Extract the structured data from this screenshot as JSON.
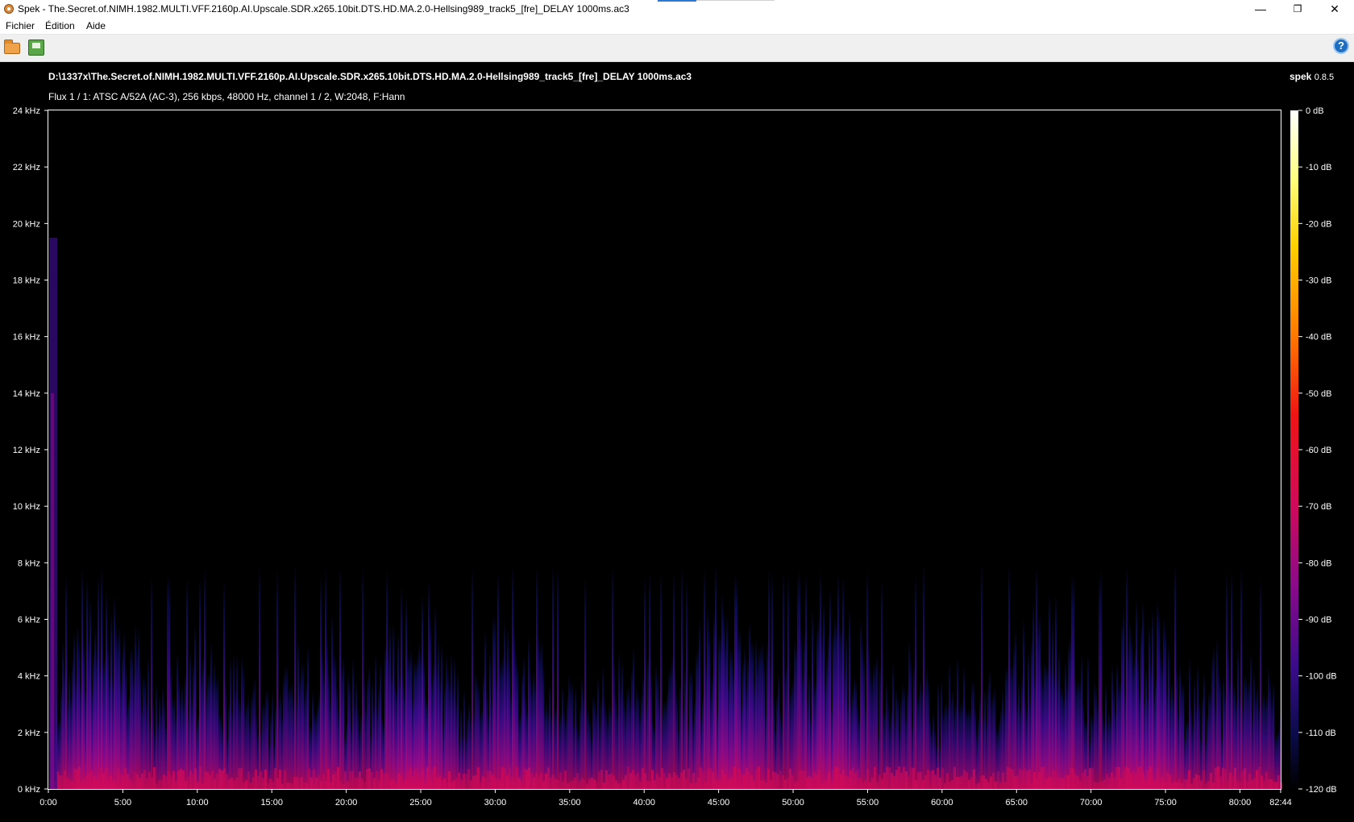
{
  "window": {
    "title": "Spek - The.Secret.of.NIMH.1982.MULTI.VFF.2160p.AI.Upscale.SDR.x265.10bit.DTS.HD.MA.2.0-Hellsing989_track5_[fre]_DELAY 1000ms.ac3",
    "minimize_glyph": "—",
    "restore_glyph": "❐",
    "close_glyph": "✕"
  },
  "menu": {
    "file": "Fichier",
    "edit": "Édition",
    "help": "Aide"
  },
  "toolbar": {
    "open_icon": "folder-open-icon",
    "save_icon": "save-image-icon",
    "help_icon": "help-icon",
    "help_glyph": "?"
  },
  "analysis": {
    "file_path": "D:\\1337x\\The.Secret.of.NIMH.1982.MULTI.VFF.2160p.AI.Upscale.SDR.x265.10bit.DTS.HD.MA.2.0-Hellsing989_track5_[fre]_DELAY 1000ms.ac3",
    "stream_info": "Flux 1 / 1: ATSC A/52A (AC-3), 256 kbps, 48000 Hz, channel 1 / 2, W:2048, F:Hann",
    "brand_name": "spek",
    "brand_version": "0.8.5"
  },
  "chart_data": {
    "type": "heatmap",
    "freq_unit": "kHz",
    "freq_range": [
      0,
      24
    ],
    "freq_ticks": [
      "0 kHz",
      "2 kHz",
      "4 kHz",
      "6 kHz",
      "8 kHz",
      "10 kHz",
      "12 kHz",
      "14 kHz",
      "16 kHz",
      "18 kHz",
      "20 kHz",
      "22 kHz",
      "24 kHz"
    ],
    "time_range_seconds": [
      0,
      4964
    ],
    "time_ticks": [
      "0:00",
      "5:00",
      "10:00",
      "15:00",
      "20:00",
      "25:00",
      "30:00",
      "35:00",
      "40:00",
      "45:00",
      "50:00",
      "55:00",
      "60:00",
      "65:00",
      "70:00",
      "75:00",
      "80:00",
      "82:44"
    ],
    "db_range": [
      -120,
      0
    ],
    "db_ticks": [
      "0 dB",
      "-10 dB",
      "-20 dB",
      "-30 dB",
      "-40 dB",
      "-50 dB",
      "-60 dB",
      "-70 dB",
      "-80 dB",
      "-90 dB",
      "-100 dB",
      "-110 dB",
      "-120 dB"
    ],
    "colormap": [
      "#000000",
      "#0b0b4a",
      "#3a0b8a",
      "#8a0a8a",
      "#d00a5a",
      "#f01414",
      "#ff7a00",
      "#ffd000",
      "#ffff80",
      "#ffffff"
    ],
    "content_cutoff_khz": 8,
    "initial_burst_cutoff_khz": 19.5
  }
}
